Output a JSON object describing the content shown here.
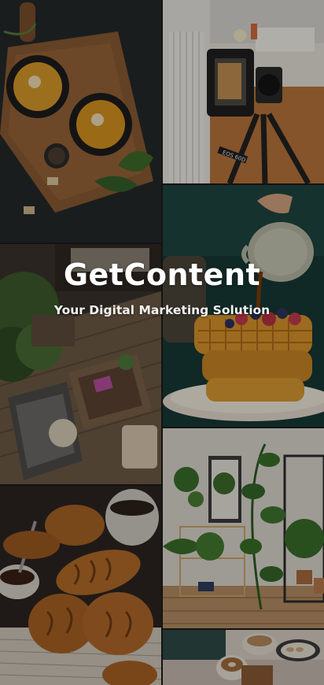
{
  "brand": {
    "title": "GetContent",
    "tagline": "Your Digital Marketing Solution"
  },
  "camera_label": "EOS 60D",
  "tiles": [
    {
      "name": "photo-tile-soup-board"
    },
    {
      "name": "photo-tile-camera-tripod"
    },
    {
      "name": "photo-tile-waffles-syrup"
    },
    {
      "name": "photo-tile-living-room"
    },
    {
      "name": "photo-tile-croissants"
    },
    {
      "name": "photo-tile-houseplants"
    },
    {
      "name": "photo-tile-coffee-table"
    }
  ]
}
